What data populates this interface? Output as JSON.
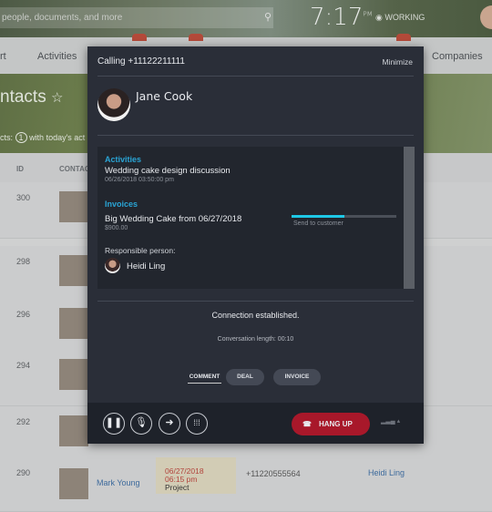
{
  "topbar": {
    "search_placeholder": "people, documents, and more",
    "clock": "7:17",
    "clock_suffix": "PM",
    "status": "WORKING"
  },
  "nav": {
    "items": [
      {
        "label": "rt"
      },
      {
        "label": "Activities"
      },
      {
        "label": "Companies"
      }
    ]
  },
  "page": {
    "title": "ntacts",
    "filter_prefix": "cts:",
    "filter_count": "1",
    "filter_suffix": "with today's act"
  },
  "table": {
    "headers": [
      "ID",
      "CONTAC"
    ],
    "rows": [
      {
        "id": "300"
      },
      {
        "id": "298"
      },
      {
        "id": "296"
      },
      {
        "id": "294"
      },
      {
        "id": "292"
      },
      {
        "id": "290",
        "name": "Mark Young",
        "date": "06/27/2018",
        "time": "06:15 pm",
        "activity": "Project",
        "phone": "+11220555564",
        "responsible": "Heidi Ling"
      }
    ]
  },
  "dialog": {
    "title": "Calling +11122211111",
    "minimize": "Minimize",
    "contact_name": "Jane Cook",
    "activities_label": "Activities",
    "activity_title": "Wedding cake design discussion",
    "activity_date": "06/26/2018 03:50:00 pm",
    "invoices_label": "Invoices",
    "invoice_title": "Big Wedding Cake from 06/27/2018",
    "invoice_amount": "$900.00",
    "invoice_status": "Send to customer",
    "invoice_progress": 0.5,
    "responsible_label": "Responsible person:",
    "responsible_name": "Heidi Ling",
    "connection": "Connection established.",
    "length": "Conversation length: 00:10",
    "tabs": [
      "COMMENT",
      "DEAL",
      "INVOICE"
    ],
    "hangup": "HANG UP",
    "colors": {
      "accent": "#2aa5d6",
      "progress": "#1ec8e6",
      "hangup": "#a8182a"
    }
  }
}
